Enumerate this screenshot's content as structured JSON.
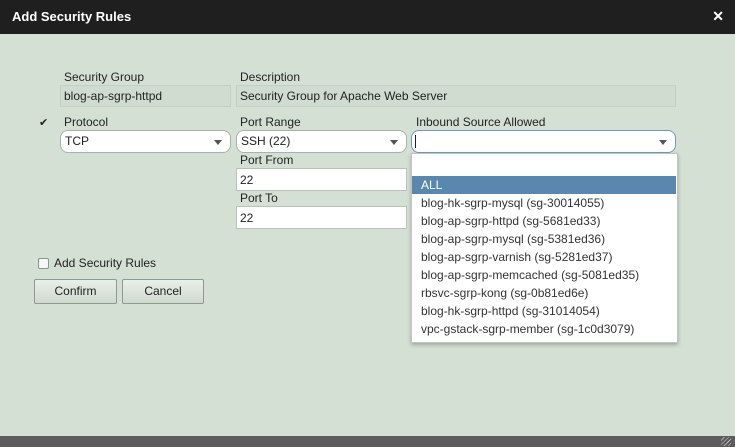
{
  "window": {
    "title": "Add Security Rules"
  },
  "form": {
    "security_group_label": "Security Group",
    "security_group_value": "blog-ap-sgrp-httpd",
    "description_label": "Description",
    "description_value": "Security Group for Apache Web Server",
    "protocol_label": "Protocol",
    "protocol_value": "TCP",
    "port_range_label": "Port Range",
    "port_range_value": "SSH (22)",
    "inbound_label": "Inbound Source Allowed",
    "inbound_value": "",
    "port_from_label": "Port From",
    "port_from_value": "22",
    "port_to_label": "Port To",
    "port_to_value": "22",
    "rule_checked": true,
    "add_rules_label": "Add Security Rules",
    "add_rules_checked": false
  },
  "buttons": {
    "confirm": "Confirm",
    "cancel": "Cancel"
  },
  "dropdown": {
    "items": [
      "",
      "ALL",
      "blog-hk-sgrp-mysql (sg-30014055)",
      "blog-ap-sgrp-httpd (sg-5681ed33)",
      "blog-ap-sgrp-mysql (sg-5381ed36)",
      "blog-ap-sgrp-varnish (sg-5281ed37)",
      "blog-ap-sgrp-memcached (sg-5081ed35)",
      "rbsvc-sgrp-kong (sg-0b81ed6e)",
      "blog-hk-sgrp-httpd (sg-31014054)",
      "vpc-gstack-sgrp-member (sg-1c0d3079)"
    ],
    "selected_index": 1
  },
  "colors": {
    "background": "#d5e0d5",
    "titlebar": "#1f1f1f",
    "selection": "#5a87ad"
  }
}
